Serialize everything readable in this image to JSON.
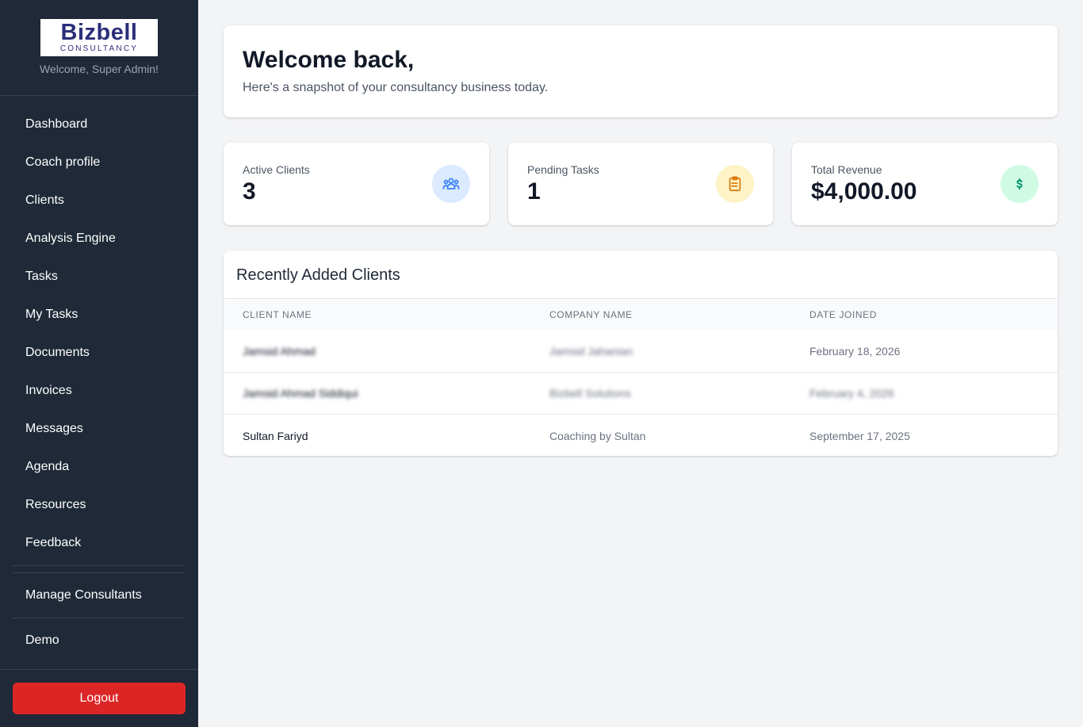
{
  "sidebar": {
    "logo_main": "Bizbell",
    "logo_sub": "CONSULTANCY",
    "welcome": "Welcome, Super Admin!",
    "items": [
      {
        "label": "Dashboard"
      },
      {
        "label": "Coach profile"
      },
      {
        "label": "Clients"
      },
      {
        "label": "Analysis Engine"
      },
      {
        "label": "Tasks"
      },
      {
        "label": "My Tasks"
      },
      {
        "label": "Documents"
      },
      {
        "label": "Invoices"
      },
      {
        "label": "Messages"
      },
      {
        "label": "Agenda"
      },
      {
        "label": "Resources"
      },
      {
        "label": "Feedback"
      }
    ],
    "admin_items": [
      {
        "label": "Manage Consultants"
      },
      {
        "label": "Demo"
      }
    ],
    "logout_label": "Logout"
  },
  "welcome_card": {
    "title": "Welcome back,",
    "subtitle": "Here's a snapshot of your consultancy business today."
  },
  "stats": [
    {
      "label": "Active Clients",
      "value": "3",
      "icon": "users-icon",
      "icon_bg": "#dbeafe",
      "icon_color": "#3b82f6"
    },
    {
      "label": "Pending Tasks",
      "value": "1",
      "icon": "clipboard-icon",
      "icon_bg": "#fef3c7",
      "icon_color": "#d97706"
    },
    {
      "label": "Total Revenue",
      "value": "$4,000.00",
      "icon": "dollar-icon",
      "icon_bg": "#d1fae5",
      "icon_color": "#059669"
    }
  ],
  "recent_clients": {
    "title": "Recently Added Clients",
    "columns": [
      "CLIENT NAME",
      "COMPANY NAME",
      "DATE JOINED"
    ],
    "rows": [
      {
        "client": "Jamsid Ahmad",
        "company": "Jamsid Jahanian",
        "date": "February 18, 2026",
        "blurred": true
      },
      {
        "client": "Jamsid Ahmad Siddiqui",
        "company": "Bizbell Solutions",
        "date": "February 4, 2026",
        "blurred": true
      },
      {
        "client": "Sultan Fariyd",
        "company": "Coaching by Sultan",
        "date": "September 17, 2025",
        "blurred": false
      }
    ]
  },
  "colors": {
    "sidebar_bg": "#1f2937",
    "logout_bg": "#dc2626",
    "page_bg": "#f3f4f6"
  }
}
